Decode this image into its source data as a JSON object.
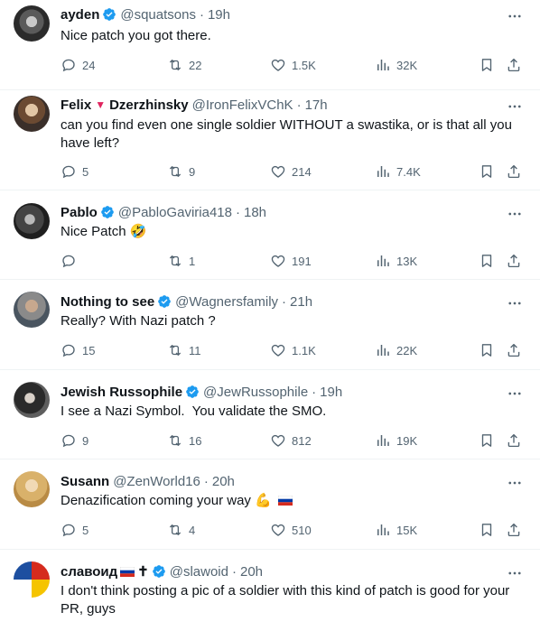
{
  "tweets": [
    {
      "name": "ayden",
      "verified": true,
      "handle": "@squatsons",
      "time": "19h",
      "text": "Nice patch you got there.",
      "replies": "24",
      "reposts": "22",
      "likes": "1.5K",
      "views": "32K"
    },
    {
      "name_a": "Felix",
      "name_b": "Dzerzhinsky",
      "verified": false,
      "handle": "@IronFelixVChK",
      "time": "17h",
      "text": "can you find even one single soldier WITHOUT a swastika, or is that all you have left?",
      "replies": "5",
      "reposts": "9",
      "likes": "214",
      "views": "7.4K"
    },
    {
      "name": "Pablo",
      "verified": true,
      "handle": "@PabloGaviria418",
      "time": "18h",
      "text": "Nice Patch",
      "emoji": "🤣",
      "replies": "",
      "reposts": "1",
      "likes": "191",
      "views": "13K"
    },
    {
      "name": "Nothing to see",
      "verified": true,
      "handle": "@Wagnersfamily",
      "time": "21h",
      "text": "Really? With Nazi patch ?",
      "replies": "15",
      "reposts": "11",
      "likes": "1.1K",
      "views": "22K"
    },
    {
      "name": "Jewish Russophile",
      "verified": true,
      "handle": "@JewRussophile",
      "time": "19h",
      "text": "I see a Nazi Symbol.  You validate the SMO.",
      "replies": "9",
      "reposts": "16",
      "likes": "812",
      "views": "19K"
    },
    {
      "name": "Susann",
      "verified": false,
      "handle": "@ZenWorld16",
      "time": "20h",
      "text": "Denazification coming your way",
      "emoji": "💪",
      "replies": "5",
      "reposts": "4",
      "likes": "510",
      "views": "15K"
    },
    {
      "name": "славоид",
      "name_suffix": "✝",
      "verified": true,
      "handle": "@slawoid",
      "time": "20h",
      "text": "I don't think posting a pic of a soldier with this kind of patch is good for your PR, guys"
    }
  ],
  "colors": {
    "verified": "#1d9bf0",
    "text": "#0f1419",
    "muted": "#536471",
    "divider": "#eff3f4"
  },
  "icons": [
    "reply-icon",
    "repost-icon",
    "like-icon",
    "views-icon",
    "bookmark-icon",
    "share-icon",
    "more-icon",
    "verified-badge-icon"
  ]
}
